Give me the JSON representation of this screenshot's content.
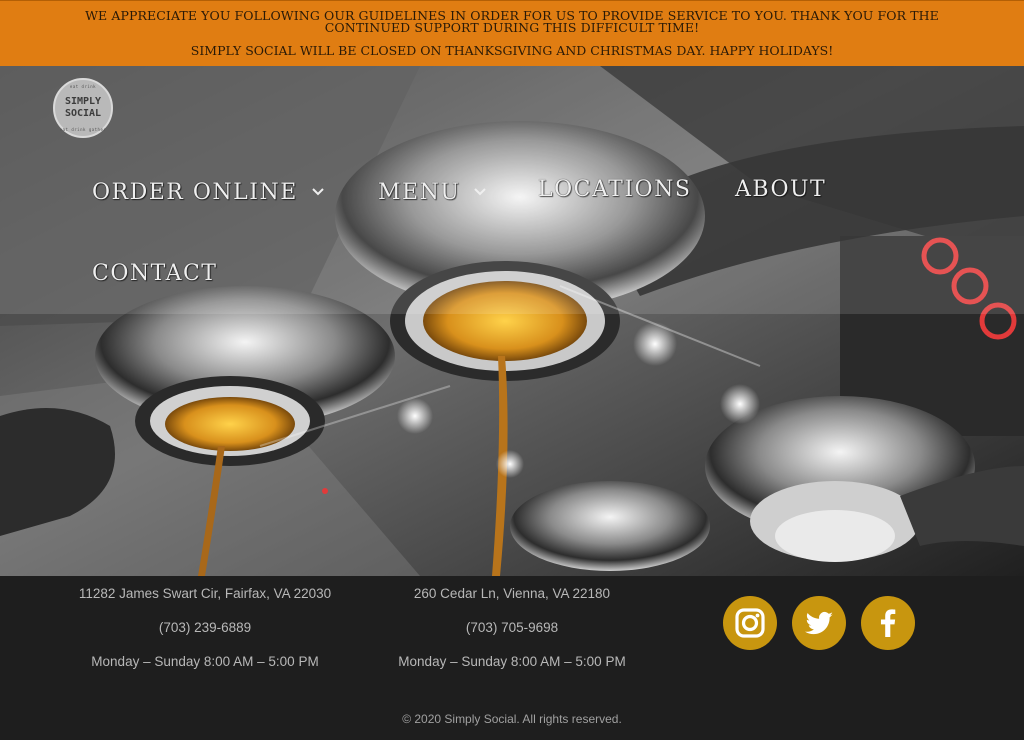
{
  "announcement": {
    "line1": "WE APPRECIATE YOU FOLLOWING OUR GUIDELINES IN ORDER FOR US TO PROVIDE SERVICE TO YOU. THANK YOU FOR THE CONTINUED SUPPORT DURING THIS DIFFICULT TIME!",
    "line2": "SIMPLY SOCIAL WILL BE CLOSED ON THANKSGIVING AND CHRISTMAS DAY. HAPPY HOLIDAYS!"
  },
  "logo": {
    "top_text": "eat drink",
    "word1": "SIMPLY",
    "word2": "SOCIAL",
    "bottom_text": "eat drink gather"
  },
  "nav": {
    "order_online": "ORDER ONLINE",
    "menu": "MENU",
    "locations": "LOCATIONS",
    "about": "ABOUT",
    "contact": "CONTACT",
    "dropdown_icon": "chevron-down-icon"
  },
  "locations": [
    {
      "address": "11282 James Swart Cir, Fairfax, VA 22030",
      "phone": "(703) 239-6889",
      "hours": "Monday – Sunday  8:00 AM – 5:00 PM"
    },
    {
      "address": "260 Cedar Ln, Vienna, VA 22180",
      "phone": "(703) 705-9698",
      "hours": "Monday – Sunday  8:00 AM – 5:00 PM"
    }
  ],
  "social": {
    "icons": [
      "instagram-icon",
      "twitter-icon",
      "facebook-icon"
    ],
    "color": "#c8960f"
  },
  "copyright": "© 2020 Simply Social. All rights reserved.",
  "colors": {
    "announcement_bg": "#e07d12",
    "footer_bg": "#1e1e1e",
    "accent": "#c8960f"
  }
}
